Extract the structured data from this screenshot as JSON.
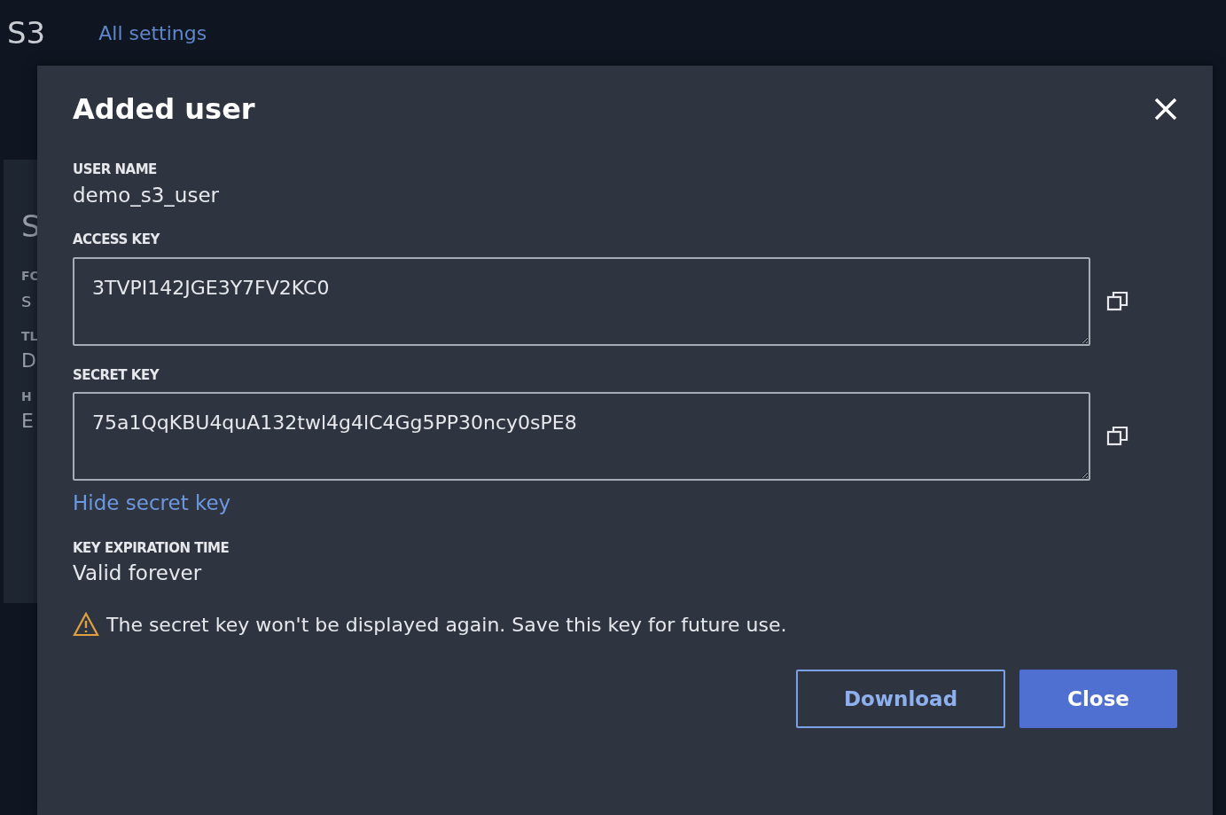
{
  "app": {
    "title": "S3",
    "nav_link": "All settings"
  },
  "background_fragments": [
    {
      "kind": "heading",
      "text": "S"
    },
    {
      "kind": "label",
      "text": "FC"
    },
    {
      "kind": "value",
      "text": "s"
    },
    {
      "kind": "label",
      "text": "TL"
    },
    {
      "kind": "value",
      "text": "D"
    },
    {
      "kind": "label",
      "text": "H"
    },
    {
      "kind": "value",
      "text": "E"
    }
  ],
  "dialog": {
    "title": "Added user",
    "fields": [
      {
        "kind": "text",
        "label": "USER NAME",
        "value": "demo_s3_user"
      },
      {
        "kind": "textarea",
        "label": "ACCESS KEY",
        "value": "3TVPI142JGE3Y7FV2KC0"
      },
      {
        "kind": "textarea",
        "label": "SECRET KEY",
        "value": "75a1QqKBU4quA132twl4g4lC4Gg5PP30ncy0sPE8"
      },
      {
        "kind": "link",
        "label": "Hide secret key"
      },
      {
        "kind": "text",
        "label": "KEY EXPIRATION TIME",
        "value": "Valid forever"
      }
    ],
    "warning": "The secret key won't be displayed again. Save this key for future use.",
    "buttons": [
      {
        "kind": "outline",
        "label": "Download"
      },
      {
        "kind": "primary",
        "label": "Close"
      }
    ]
  }
}
